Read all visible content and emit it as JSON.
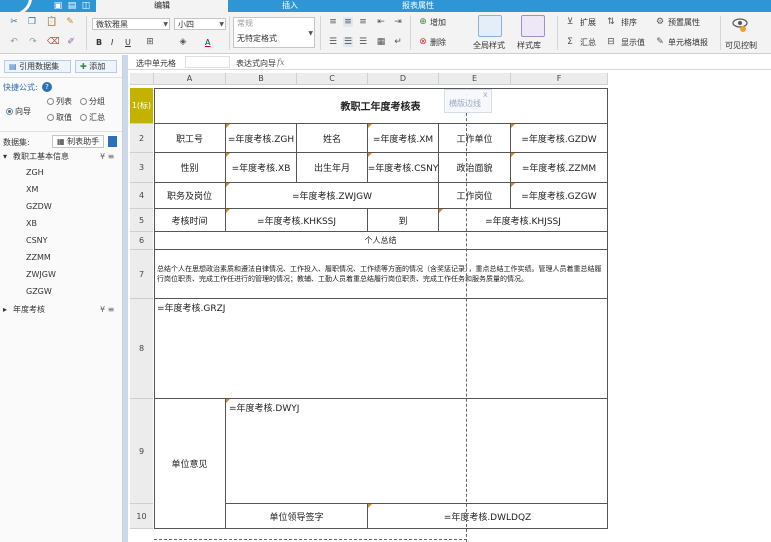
{
  "tabs": [
    "编辑",
    "插入",
    "报表属性"
  ],
  "ribbon": {
    "font_name": "微软雅黑",
    "font_size": "小四",
    "format_label": "常规",
    "format_value": "无特定格式",
    "bold": "B",
    "italic": "I",
    "underline": "U",
    "font_color_label": "A",
    "add_label": "增加",
    "delete_label": "删除",
    "global_style": "全局样式",
    "style_lib": "样式库",
    "expand": "扩展",
    "sort": "排序",
    "summary": "汇总",
    "display_value": "显示值",
    "preset_attr": "预置属性",
    "cell_fill": "单元格填报",
    "visible_ctrl": "可见控制"
  },
  "left_panel": {
    "ref_dataset": "引用数据集",
    "add": "添加",
    "quick_formula": "快捷公式:",
    "help": "?",
    "opt_wizard": "向导",
    "opt_list": "列表",
    "opt_group": "分组",
    "opt_value": "取值",
    "opt_summary": "汇总",
    "dataset_label": "数据集:",
    "make_table": "制表助手",
    "tree_group1": "教职工基本信息",
    "fields": [
      "ZGH",
      "XM",
      "GZDW",
      "XB",
      "CSNY",
      "ZZMM",
      "ZWJGW",
      "GZGW"
    ],
    "tree_group2": "年度考核"
  },
  "formula_bar": {
    "cell_label": "选中单元格",
    "cell_value": "",
    "expr_label": "表达式向导",
    "fx": "fx"
  },
  "columns": [
    "A",
    "B",
    "C",
    "D",
    "E",
    "F"
  ],
  "rows": [
    "1(标)",
    "2",
    "3",
    "4",
    "5",
    "6",
    "7",
    "8",
    "9",
    "10"
  ],
  "sheet": {
    "title": "教职工年度考核表",
    "r2": [
      "职工号",
      "=年度考核.ZGH",
      "姓名",
      "=年度考核.XM",
      "工作单位",
      "=年度考核.GZDW"
    ],
    "r3": [
      "性别",
      "=年度考核.XB",
      "出生年月",
      "=年度考核.CSNY",
      "政治面貌",
      "=年度考核.ZZMM"
    ],
    "r4": [
      "职务及岗位",
      "=年度考核.ZWJGW",
      "工作岗位",
      "=年度考核.GZGW"
    ],
    "r5": [
      "考核时间",
      "=年度考核.KHKSSJ",
      "到",
      "=年度考核.KHJSSJ"
    ],
    "r6": "个人总结",
    "r7": "总结个人在思想政治素质和遵法自律情况、工作投入、履职情况、工作绩等方面的情况（含奖惩记录），重点总结工作实绩。管理人员着重总结履行岗位职责、完成工作任进行的管理的情况；教辅、工勤人员着重总结履行岗位职责、完成工作任务和服务质量的情况。",
    "r8": "=年度考核.GRZJ",
    "r9_label": "单位意见",
    "r9_value": "=年度考核.DWYJ",
    "r10_label": "单位领导签字",
    "r10_value": "=年度考核.DWLDQZ"
  },
  "tooltip": {
    "text": "横版边线",
    "close": "x"
  }
}
